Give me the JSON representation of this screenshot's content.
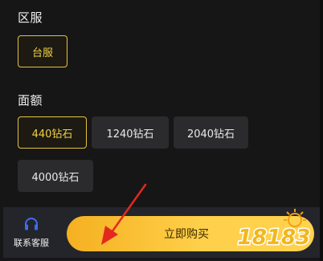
{
  "region": {
    "title": "区服",
    "options": [
      {
        "label": "台服",
        "selected": true
      }
    ]
  },
  "denomination": {
    "title": "面额",
    "options": [
      {
        "label": "440钻石",
        "selected": true
      },
      {
        "label": "1240钻石",
        "selected": false
      },
      {
        "label": "2040钻石",
        "selected": false
      },
      {
        "label": "4000钻石",
        "selected": false
      }
    ]
  },
  "bottom_bar": {
    "service_label": "联系客服",
    "service_icon": "headset-icon",
    "buy_label": "立即购买"
  },
  "watermark": {
    "text": "18183"
  },
  "colors": {
    "accent": "#e7c23f",
    "background": "#161616",
    "option_bg": "#2b2b2e",
    "button_gradient_start": "#f5b021",
    "button_gradient_end": "#ffd24f",
    "arrow": "#e4281e"
  }
}
